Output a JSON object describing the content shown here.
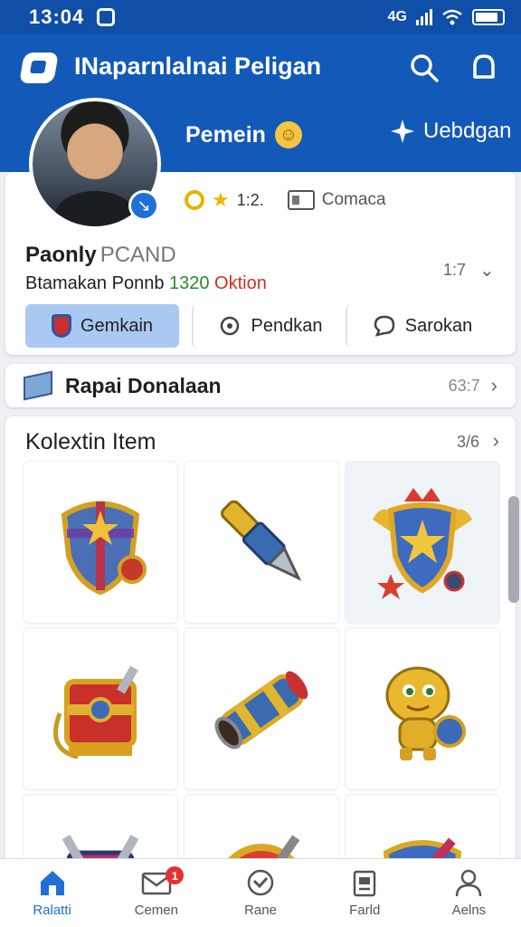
{
  "status_bar": {
    "time": "13:04",
    "network_label": "4G"
  },
  "header": {
    "title": "INaparnlalnai Peligan",
    "player_label": "Pemein",
    "update_label": "Uebdgan"
  },
  "profile": {
    "level_stat": "1:2.",
    "comaca_label": "Comaca",
    "name": "Paonly",
    "code": "PCAND",
    "subtitle_prefix": "Btamakan Ponnb ",
    "subtitle_green": "1320",
    "subtitle_red": " Oktion",
    "count": "1:7",
    "buttons": [
      {
        "label": "Gemkain"
      },
      {
        "label": "Pendkan"
      },
      {
        "label": "Sarokan"
      }
    ]
  },
  "rapai": {
    "label": "Rapai Donalaan",
    "count": "63:7"
  },
  "collection": {
    "title": "Kolextin Item",
    "count": "3/6",
    "items": [
      {
        "name": "shield-crossed-swords",
        "icon": "shield-icon"
      },
      {
        "name": "rocket-bullet",
        "icon": "bullet-icon"
      },
      {
        "name": "winged-crest",
        "icon": "crest-icon"
      },
      {
        "name": "treasure-chest",
        "icon": "chest-icon"
      },
      {
        "name": "cannon",
        "icon": "cannon-icon"
      },
      {
        "name": "golden-creature",
        "icon": "creature-icon"
      },
      {
        "name": "sword-banner",
        "icon": "banner-icon"
      },
      {
        "name": "round-shield",
        "icon": "round-shield-icon"
      },
      {
        "name": "blue-shield",
        "icon": "blue-shield-icon"
      }
    ]
  },
  "bottom_nav": [
    {
      "label": "Ralatti",
      "icon": "home-icon",
      "active": true
    },
    {
      "label": "Cemen",
      "icon": "mail-icon",
      "badge": "1"
    },
    {
      "label": "Rane",
      "icon": "check-circle-icon"
    },
    {
      "label": "Farld",
      "icon": "clipboard-icon"
    },
    {
      "label": "Aelns",
      "icon": "user-icon"
    }
  ],
  "colors": {
    "primary": "#1259b8",
    "accent": "#1f6fd6",
    "selected_button": "#a9c9f2"
  }
}
